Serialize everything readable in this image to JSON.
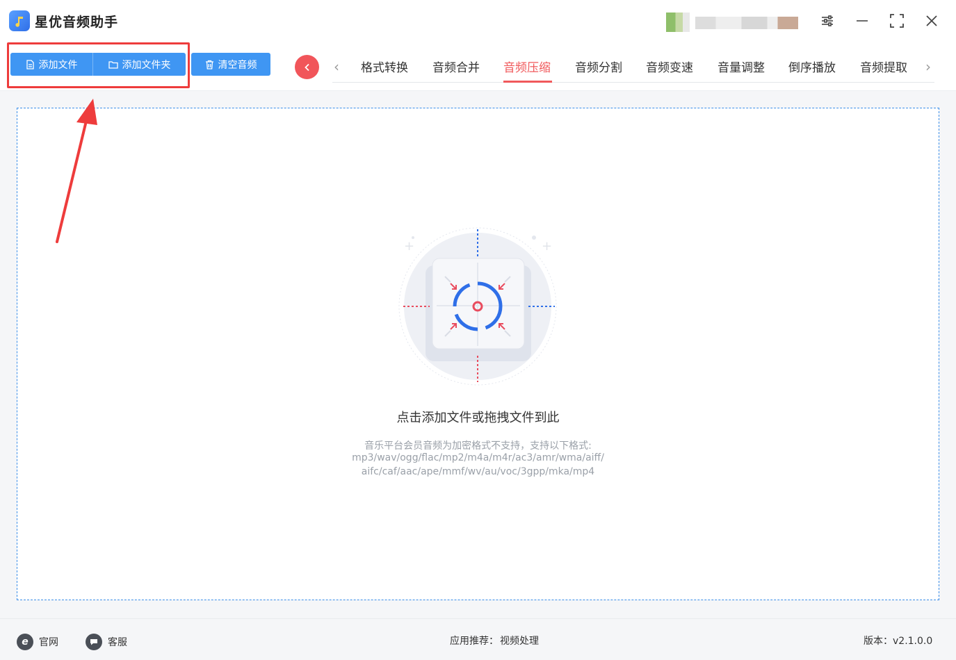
{
  "app": {
    "title": "星优音频助手"
  },
  "toolbar": {
    "add_file": "添加文件",
    "add_folder": "添加文件夹",
    "clear_audio": "清空音频"
  },
  "tabs": [
    {
      "label": "格式转换"
    },
    {
      "label": "音频合并"
    },
    {
      "label": "音频压缩",
      "active": true
    },
    {
      "label": "音频分割"
    },
    {
      "label": "音频变速"
    },
    {
      "label": "音量调整"
    },
    {
      "label": "倒序播放"
    },
    {
      "label": "音频提取"
    }
  ],
  "dropzone": {
    "title": "点击添加文件或拖拽文件到此",
    "note_line1": "音乐平台会员音频为加密格式不支持，支持以下格式:",
    "note_line2": "mp3/wav/ogg/flac/mp2/m4a/m4r/ac3/amr/wma/aiff/",
    "note_line3": "aifc/caf/aac/ape/mmf/wv/au/voc/3gpp/mka/mp4"
  },
  "footer": {
    "website": "官网",
    "support": "客服",
    "recommend_label": "应用推荐：",
    "recommend_value": "视频处理",
    "version": "版本：v2.1.0.0"
  },
  "colors": {
    "accent": "#3f96f3",
    "active_tab": "#f0595b",
    "highlight": "#ee3c3c"
  }
}
